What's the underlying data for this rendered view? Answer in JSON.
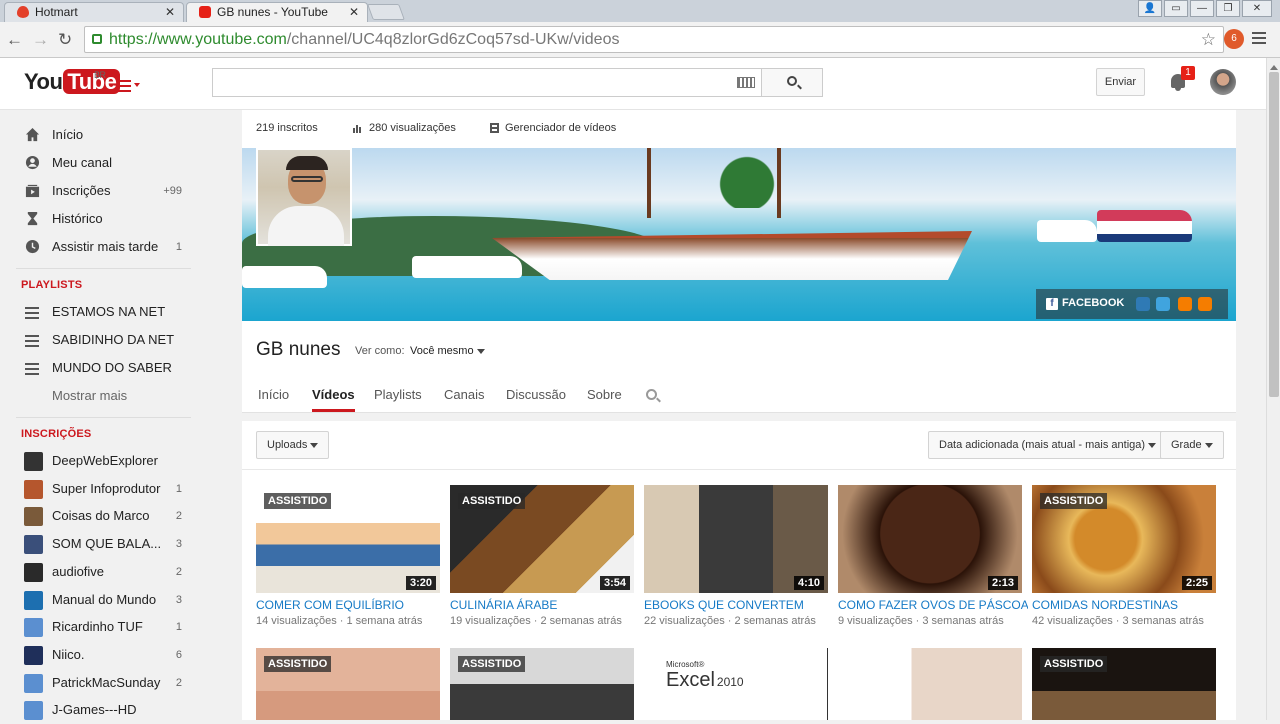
{
  "browser": {
    "tabs": [
      {
        "title": "Hotmart",
        "active": false
      },
      {
        "title": "GB nunes - YouTube",
        "active": true
      }
    ],
    "url_host": "https://www.youtube.com",
    "url_path": "/channel/UC4q8zlorGd6zCoq57sd-UKw/videos",
    "ext_badge": "6",
    "window_close": "✕",
    "window_min": "—",
    "window_max": "❐",
    "window_user": "👤",
    "tab_close": "✕"
  },
  "header": {
    "logo_you": "You",
    "logo_tube": "Tube",
    "logo_region": "BR",
    "search_placeholder": "",
    "upload_label": "Enviar",
    "notification_count": "1"
  },
  "guide": {
    "main": [
      {
        "label": "Início",
        "count": ""
      },
      {
        "label": "Meu canal",
        "count": ""
      },
      {
        "label": "Inscrições",
        "count": "+99"
      },
      {
        "label": "Histórico",
        "count": ""
      },
      {
        "label": "Assistir mais tarde",
        "count": "1"
      }
    ],
    "playlists_heading": "PLAYLISTS",
    "playlists": [
      {
        "label": "ESTAMOS NA NET"
      },
      {
        "label": "SABIDINHO DA NET"
      },
      {
        "label": "MUNDO DO SABER"
      }
    ],
    "more_label": "Mostrar mais",
    "subscriptions_heading": "INSCRIÇÕES",
    "subscriptions": [
      {
        "label": "DeepWebExplorer",
        "count": "",
        "color": "#333333"
      },
      {
        "label": "Super Infoprodutor",
        "count": "1",
        "color": "#b5562d"
      },
      {
        "label": "Coisas do Marco",
        "count": "2",
        "color": "#7a5a3a"
      },
      {
        "label": "SOM QUE BALA...",
        "count": "3",
        "color": "#3a4f7a"
      },
      {
        "label": "audiofive",
        "count": "2",
        "color": "#2a2a2a"
      },
      {
        "label": "Manual do Mundo",
        "count": "3",
        "color": "#1d6fb0"
      },
      {
        "label": "Ricardinho TUF",
        "count": "1",
        "color": "#5b8fd0"
      },
      {
        "label": "Niico.",
        "count": "6",
        "color": "#1f2f5a"
      },
      {
        "label": "PatrickMacSunday",
        "count": "2",
        "color": "#5b8fd0"
      },
      {
        "label": "J-Games---HD",
        "count": "",
        "color": "#5b8fd0"
      }
    ]
  },
  "channel": {
    "subscribers": "219 inscritos",
    "views": "280 visualizações",
    "video_manager": "Gerenciador de vídeos",
    "name": "GB nunes",
    "view_as_label": "Ver como:",
    "view_as_value": "Você mesmo",
    "facebook_label": "FACEBOOK",
    "facebook_icon": "f",
    "tabs": [
      {
        "label": "Início",
        "selected": false
      },
      {
        "label": "Vídeos",
        "selected": true
      },
      {
        "label": "Playlists",
        "selected": false
      },
      {
        "label": "Canais",
        "selected": false
      },
      {
        "label": "Discussão",
        "selected": false
      },
      {
        "label": "Sobre",
        "selected": false
      }
    ]
  },
  "videos_toolbar": {
    "uploads_label": "Uploads",
    "sort_label": "Data adicionada (mais atual - mais antiga)",
    "view_label": "Grade"
  },
  "videos": [
    {
      "title": "COMER COM EQUILÍBRIO",
      "views": "14 visualizações",
      "age": "1 semana atrás",
      "duration": "3:20",
      "watched": "ASSISTIDO"
    },
    {
      "title": "CULINÁRIA ÁRABE",
      "views": "19 visualizações",
      "age": "2 semanas atrás",
      "duration": "3:54",
      "watched": "ASSISTIDO"
    },
    {
      "title": "EBOOKS QUE CONVERTEM",
      "views": "22 visualizações",
      "age": "2 semanas atrás",
      "duration": "4:10",
      "watched": ""
    },
    {
      "title": "COMO FAZER OVOS DE PÁSCOA",
      "views": "9 visualizações",
      "age": "3 semanas atrás",
      "duration": "2:13",
      "watched": ""
    },
    {
      "title": "COMIDAS NORDESTINAS",
      "views": "42 visualizações",
      "age": "3 semanas atrás",
      "duration": "2:25",
      "watched": "ASSISTIDO"
    }
  ],
  "videos_row2": [
    {
      "watched": "ASSISTIDO"
    },
    {
      "watched": "ASSISTIDO"
    },
    {
      "watched": ""
    },
    {
      "watched": ""
    },
    {
      "watched": "ASSISTIDO"
    }
  ],
  "excel_thumb": {
    "vendor": "Microsoft®",
    "product": "Excel",
    "version": "2010"
  },
  "colors": {
    "accent_red": "#cc181e",
    "link_blue": "#167ac6"
  }
}
